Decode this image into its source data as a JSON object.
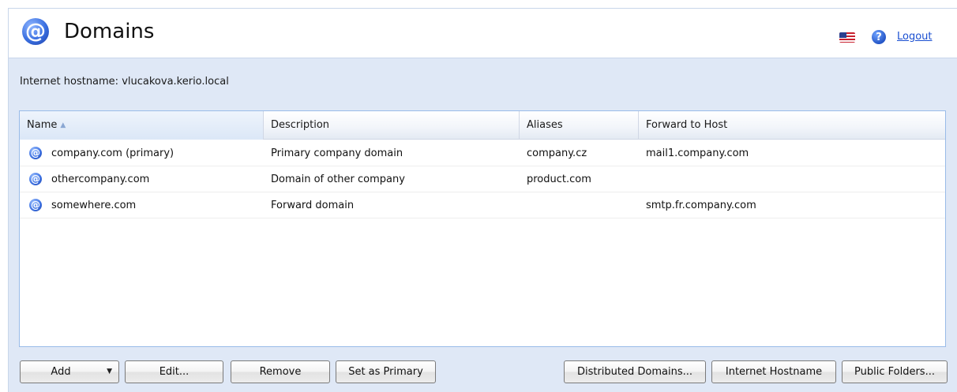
{
  "header": {
    "title": "Domains",
    "logo_icon": "at-sign-icon",
    "logout_label": "Logout",
    "help_glyph": "?",
    "logo_glyph": "@"
  },
  "hostname_text": "Internet hostname: vlucakova.kerio.local",
  "table": {
    "columns": [
      {
        "label": "Name",
        "sorted": "ascending"
      },
      {
        "label": "Description"
      },
      {
        "label": "Aliases"
      },
      {
        "label": "Forward to Host"
      }
    ],
    "row_glyph": "@",
    "rows": [
      {
        "name": "company.com (primary)",
        "description": "Primary company domain",
        "aliases": "company.cz",
        "forward": "mail1.company.com"
      },
      {
        "name": "othercompany.com",
        "description": "Domain of other company",
        "aliases": "product.com",
        "forward": ""
      },
      {
        "name": "somewhere.com",
        "description": "Forward domain",
        "aliases": "",
        "forward": "smtp.fr.company.com"
      }
    ]
  },
  "buttons": {
    "add": "Add",
    "edit": "Edit...",
    "remove": "Remove",
    "set_primary": "Set as Primary",
    "distributed": "Distributed Domains...",
    "internet_hostname": "Internet Hostname",
    "public_folders": "Public Folders..."
  },
  "colors": {
    "panel_bg": "#dfe8f6",
    "link": "#1a4fd1",
    "grid_border": "#99bbe8"
  }
}
